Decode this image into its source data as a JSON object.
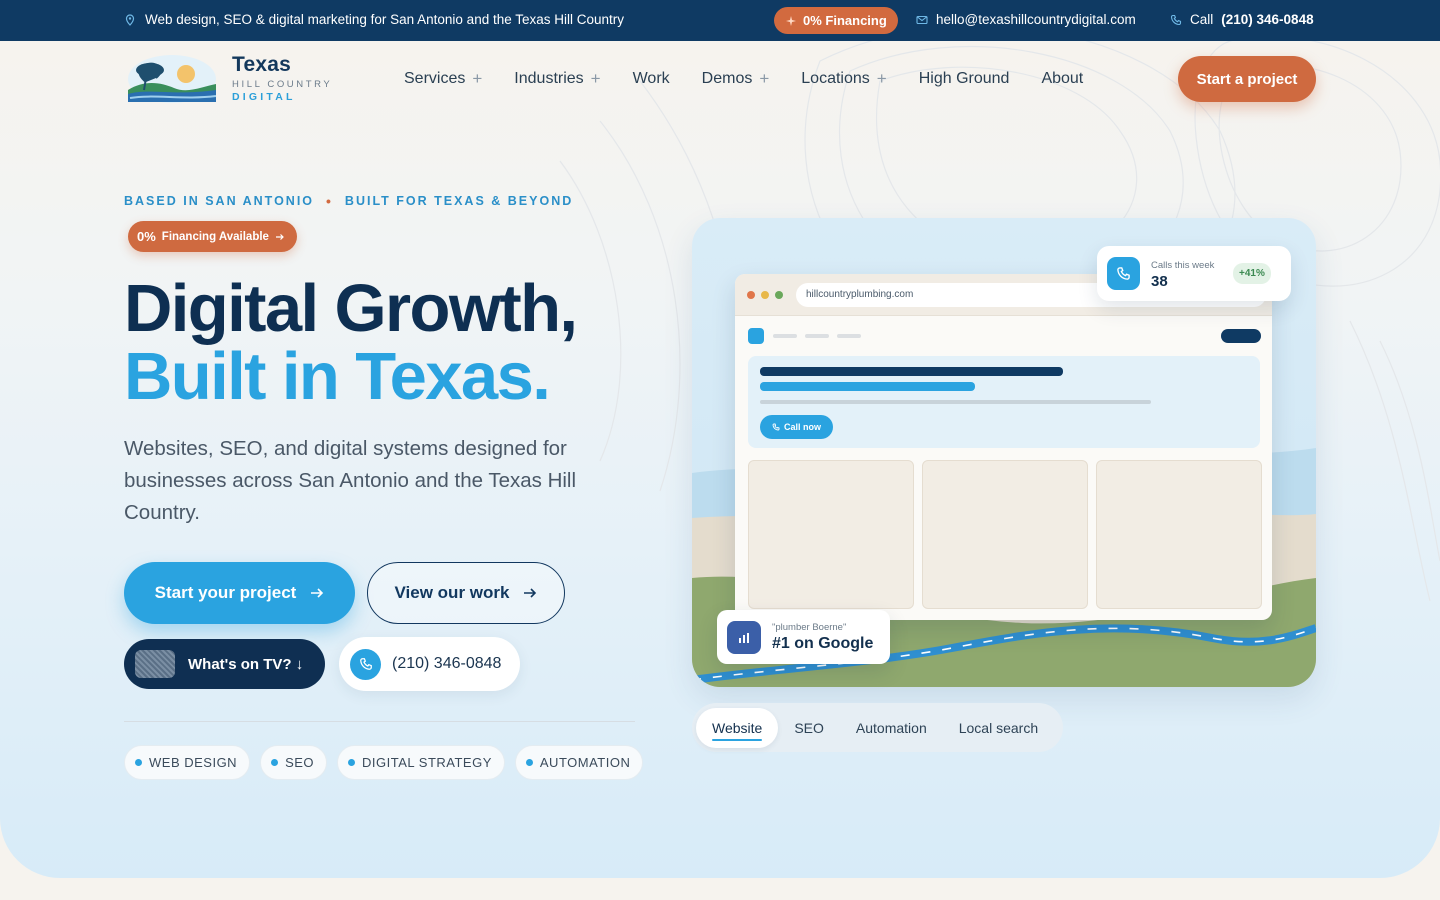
{
  "topbar": {
    "tagline": "Web design, SEO & digital marketing for San Antonio and the Texas Hill Country",
    "financing_pill": "0% Financing",
    "email": "hello@texashillcountrydigital.com",
    "phone_prefix": "Call",
    "phone_number": "(210) 346-0848"
  },
  "logo": {
    "line1": "Texas",
    "line2": "HILL COUNTRY",
    "line3": "DIGITAL"
  },
  "nav": {
    "items": [
      {
        "label": "Services",
        "has_submenu": true
      },
      {
        "label": "Industries",
        "has_submenu": true
      },
      {
        "label": "Work",
        "has_submenu": false
      },
      {
        "label": "Demos",
        "has_submenu": true
      },
      {
        "label": "Locations",
        "has_submenu": true
      },
      {
        "label": "High Ground",
        "has_submenu": false
      },
      {
        "label": "About",
        "has_submenu": false
      }
    ],
    "submenu_glyph": "+",
    "cta_label": "Start a project"
  },
  "hero": {
    "eyebrow_left": "BASED IN SAN ANTONIO",
    "eyebrow_sep": "•",
    "eyebrow_right": "BUILT FOR TEXAS & BEYOND",
    "financing_badge_big": "0%",
    "financing_badge_text": "Financing Available",
    "headline_line1": "Digital Growth,",
    "headline_line2": "Built in Texas.",
    "lead": "Websites, SEO, and digital systems designed for businesses across San Antonio and the Texas Hill Country.",
    "primary_button": "Start your project",
    "secondary_button": "View our work",
    "tv_button": "What's on TV? ↓",
    "phone_button": "(210) 346-0848",
    "tags": [
      "WEB DESIGN",
      "SEO",
      "DIGITAL STRATEGY",
      "AUTOMATION"
    ]
  },
  "visual": {
    "browser_url": "hillcountryplumbing.com",
    "call_now": "Call now",
    "stat_label": "Calls this week",
    "stat_value": "38",
    "stat_delta": "+41%",
    "rank_query": "\"plumber Boerne\"",
    "rank_result": "#1 on Google",
    "tabs": [
      "Website",
      "SEO",
      "Automation",
      "Local search"
    ],
    "active_tab": "Website"
  },
  "colors": {
    "navy": "#0f3a63",
    "accent_orange": "#cf6a40",
    "accent_blue": "#2aa3e0",
    "headline_navy": "#0e2f52"
  },
  "icons": {
    "topbar_location": "map-pin-icon",
    "topbar_financing": "sparkle-icon",
    "topbar_email": "mail-icon",
    "topbar_phone": "phone-icon",
    "arrow": "arrow-right-icon",
    "stat": "phone-icon",
    "rank": "bar-chart-icon"
  }
}
